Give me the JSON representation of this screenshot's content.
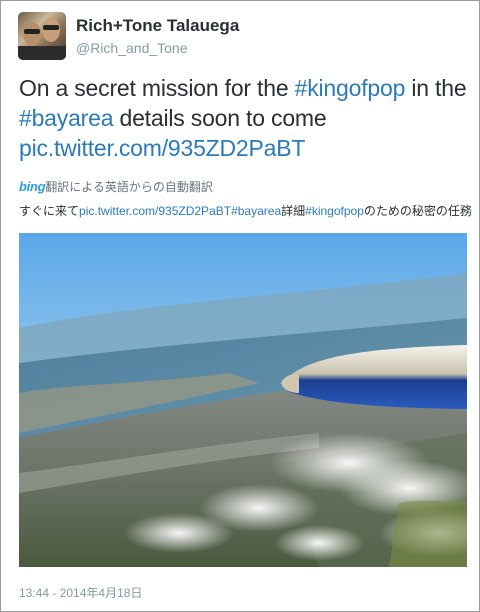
{
  "user": {
    "display_name": "Rich+Tone Talauega",
    "screen_name": "@Rich_and_Tone"
  },
  "tweet": {
    "t1": "On a secret mission for the ",
    "hashtag1": "#kingofpop",
    "t2": " in the ",
    "hashtag2": "#bayarea",
    "t3": " details soon to come ",
    "link": "pic.twitter.com/935ZD2PaBT"
  },
  "translation": {
    "bing_logo": "bing",
    "header": "翻訳による英語からの自動翻訳",
    "p1": "すぐに来て",
    "link": "pic.twitter.com/935ZD2PaBT",
    "hashtag1": "#bayarea",
    "p2": "詳細",
    "hashtag2": "#kingofpop",
    "p3": "のための秘密の任務"
  },
  "timestamp": "13:44 - 2014年4月18日",
  "colors": {
    "link": "#2b7bb9",
    "text": "#292f33",
    "muted": "#8899a6",
    "bing": "#2b9ee0"
  }
}
